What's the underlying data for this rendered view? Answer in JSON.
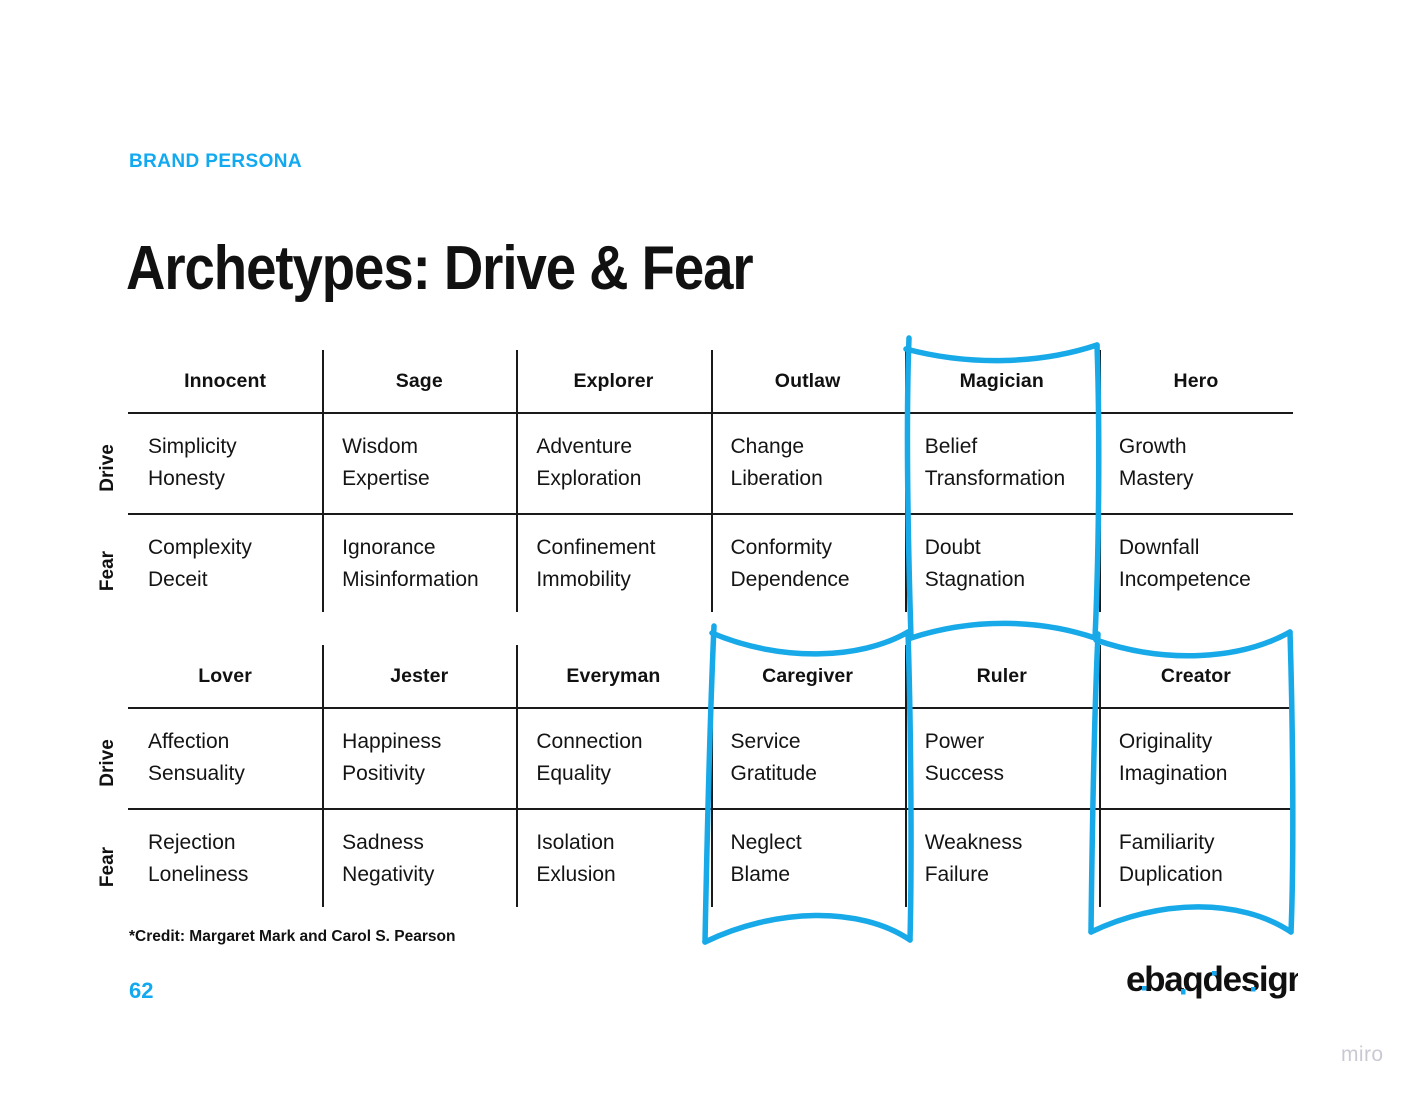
{
  "header": {
    "eyebrow": "BRAND PERSONA",
    "title": "Archetypes: Drive & Fear"
  },
  "colors": {
    "accent_blue": "#12A9F0",
    "highlight_blue": "#17A9E8",
    "text_black": "#111111",
    "rule_black": "#1a1a1a",
    "watermark_gray": "#c9c9d4"
  },
  "axis_labels": {
    "drive": "Drive",
    "fear": "Fear"
  },
  "tables": [
    {
      "id": "matrix-one",
      "headers": [
        "Innocent",
        "Sage",
        "Explorer",
        "Outlaw",
        "Magician",
        "Hero"
      ],
      "rows": [
        {
          "label": "Drive",
          "cells": [
            [
              "Simplicity",
              "Honesty"
            ],
            [
              "Wisdom",
              "Expertise"
            ],
            [
              "Adventure",
              "Exploration"
            ],
            [
              "Change",
              "Liberation"
            ],
            [
              "Belief",
              "Transformation"
            ],
            [
              "Growth",
              "Mastery"
            ]
          ]
        },
        {
          "label": "Fear",
          "cells": [
            [
              "Complexity",
              "Deceit"
            ],
            [
              "Ignorance",
              "Misinformation"
            ],
            [
              "Confinement",
              "Immobility"
            ],
            [
              "Conformity",
              "Dependence"
            ],
            [
              "Doubt",
              "Stagnation"
            ],
            [
              "Downfall",
              "Incompetence"
            ]
          ]
        }
      ]
    },
    {
      "id": "matrix-two",
      "headers": [
        "Lover",
        "Jester",
        "Everyman",
        "Caregiver",
        "Ruler",
        "Creator"
      ],
      "rows": [
        {
          "label": "Drive",
          "cells": [
            [
              "Affection",
              "Sensuality"
            ],
            [
              "Happiness",
              "Positivity"
            ],
            [
              "Connection",
              "Equality"
            ],
            [
              "Service",
              "Gratitude"
            ],
            [
              "Power",
              "Success"
            ],
            [
              "Originality",
              "Imagination"
            ]
          ]
        },
        {
          "label": "Fear",
          "cells": [
            [
              "Rejection",
              "Loneliness"
            ],
            [
              "Sadness",
              "Negativity"
            ],
            [
              "Isolation",
              "Exlusion"
            ],
            [
              "Neglect",
              "Blame"
            ],
            [
              "Weakness",
              "Failure"
            ],
            [
              "Familiarity",
              "Duplication"
            ]
          ]
        }
      ]
    }
  ],
  "highlights": [
    {
      "name": "magician",
      "column": "Magician",
      "table": "matrix-one"
    },
    {
      "name": "caregiver",
      "column": "Caregiver",
      "table": "matrix-two"
    },
    {
      "name": "creator",
      "column": "Creator",
      "table": "matrix-two"
    }
  ],
  "footer": {
    "credit": "*Credit: Margaret Mark and Carol S. Pearson",
    "page_number": "62",
    "logo_text": "ebaqdesign",
    "watermark": "miro"
  }
}
